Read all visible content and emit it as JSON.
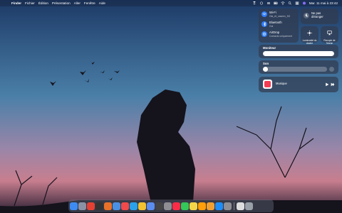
{
  "menubar": {
    "apple": "",
    "items": [
      "Finder",
      "Fichier",
      "Édition",
      "Présentation",
      "Aller",
      "Fenêtre",
      "Aide"
    ],
    "clock": "Mar. 11 mai à 23:42"
  },
  "control_center": {
    "wifi": {
      "title": "Wi-Fi",
      "subtitle": "Ola_et_caseen_5G"
    },
    "bluetooth": {
      "title": "Bluetooth",
      "subtitle": "Oui"
    },
    "airdrop": {
      "title": "AirDrop",
      "subtitle": "Contacts uniquement"
    },
    "dnd": {
      "label": "Ne pas déranger"
    },
    "brightness_kbd": {
      "label": "Luminosité du clavier"
    },
    "screen_mirror": {
      "label": "Recopie de l'écran"
    },
    "display": {
      "label": "Moniteur",
      "level": 1.0
    },
    "sound": {
      "label": "Son",
      "level": 0.0
    },
    "now_playing": {
      "app": "Musique"
    }
  },
  "dock": {
    "icons": [
      "finder-icon",
      "launchpad-icon",
      "chrome-icon",
      "terminal-icon",
      "app-orange-icon",
      "mail-icon",
      "calendar-icon",
      "app-blue-icon",
      "photos-icon",
      "preview-icon",
      "obs-icon",
      "system-preferences-icon",
      "music-icon",
      "messages-icon",
      "notes-icon",
      "photos-app-icon",
      "pencil-icon",
      "app-store-icon",
      "settings-icon",
      "document-icon",
      "trash-icon"
    ]
  },
  "colors": {
    "accent": "#2f7dfa"
  }
}
